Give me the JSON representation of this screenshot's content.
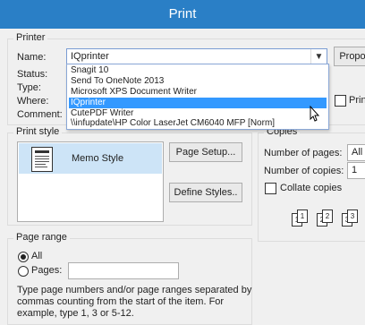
{
  "window": {
    "title": "Print"
  },
  "printer": {
    "legend": "Printer",
    "name_label": "Name:",
    "name_value": "IQprinter",
    "status_label": "Status:",
    "type_label": "Type:",
    "where_label": "Where:",
    "comment_label": "Comment:",
    "properties_label": "Propo",
    "print_to_file_label": "Print",
    "dropdown_items": [
      "Snagit 10",
      "Send To OneNote 2013",
      "Microsoft XPS Document Writer",
      "IQprinter",
      "CutePDF Writer",
      "\\\\infupdate\\HP Color LaserJet CM6040 MFP [Norm]"
    ],
    "selected_index": 3
  },
  "print_style": {
    "legend": "Print style",
    "style_name": "Memo Style",
    "page_setup_label": "Page Setup...",
    "define_styles_label": "Define Styles.."
  },
  "copies": {
    "legend": "Copies",
    "pages_label": "Number of pages:",
    "pages_value": "All",
    "copies_label": "Number of copies:",
    "copies_value": "1",
    "collate_label": "Collate copies",
    "collate_pages": [
      "1",
      "1",
      "2",
      "2",
      "3",
      "3"
    ]
  },
  "page_range": {
    "legend": "Page range",
    "all_label": "All",
    "pages_label": "Pages:",
    "help_text_1": "Type page numbers and/or page ranges separated by",
    "help_text_2": "commas counting from the start of the item.  For",
    "help_text_3": "example, type 1, 3 or 5-12."
  },
  "colors": {
    "titlebar": "#2a7fc6",
    "selection": "#3399ff"
  }
}
